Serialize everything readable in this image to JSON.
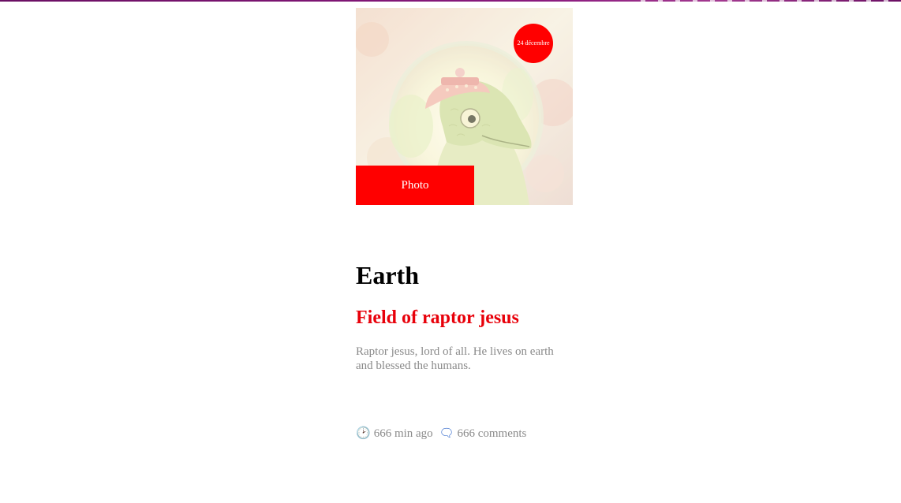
{
  "post": {
    "date_badge": "24 décembre",
    "category": "Photo",
    "title": "Earth",
    "subtitle": "Field of raptor jesus",
    "description": "Raptor jesus, lord of all. He lives on earth and blessed the humans.",
    "time_icon": "🕑",
    "time_ago": "666 min ago",
    "comments_icon": "🗨",
    "comments": "666 comments",
    "image_icon": "raptor-jesus-illustration"
  },
  "colors": {
    "accent": "#ff0000",
    "subtitle": "#e8000a",
    "muted_text": "#8a8a8a",
    "topbar": "#7a1470"
  }
}
